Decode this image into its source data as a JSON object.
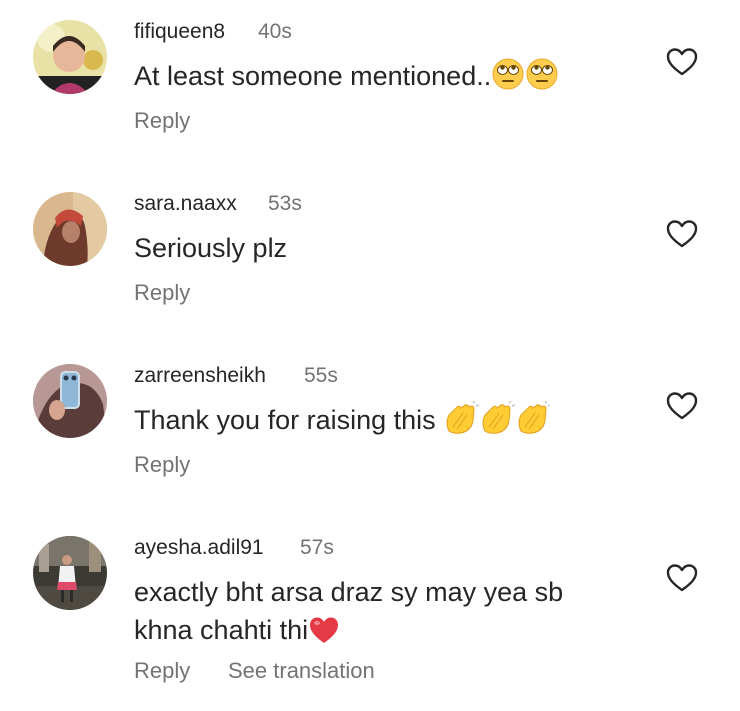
{
  "comments": [
    {
      "username": "fifiqueen8",
      "time": "40s",
      "text": "At least someone mentioned..",
      "emoji": "eye-roll",
      "reply": "Reply"
    },
    {
      "username": "sara.naaxx",
      "time": "53s",
      "text": "Seriously plz",
      "reply": "Reply"
    },
    {
      "username": "zarreensheikh",
      "time": "55s",
      "text": "Thank you for raising this",
      "emoji": "clapping-hands",
      "reply": "Reply"
    },
    {
      "username": "ayesha.adil91",
      "time": "57s",
      "text_line1": "exactly bht arsa draz sy may yea sb",
      "text_line2": "khna chahti thi",
      "emoji": "red-heart",
      "reply": "Reply",
      "see_translation": "See translation"
    }
  ],
  "colors": {
    "text": "#262626",
    "secondary": "#737373",
    "background": "#ffffff"
  }
}
